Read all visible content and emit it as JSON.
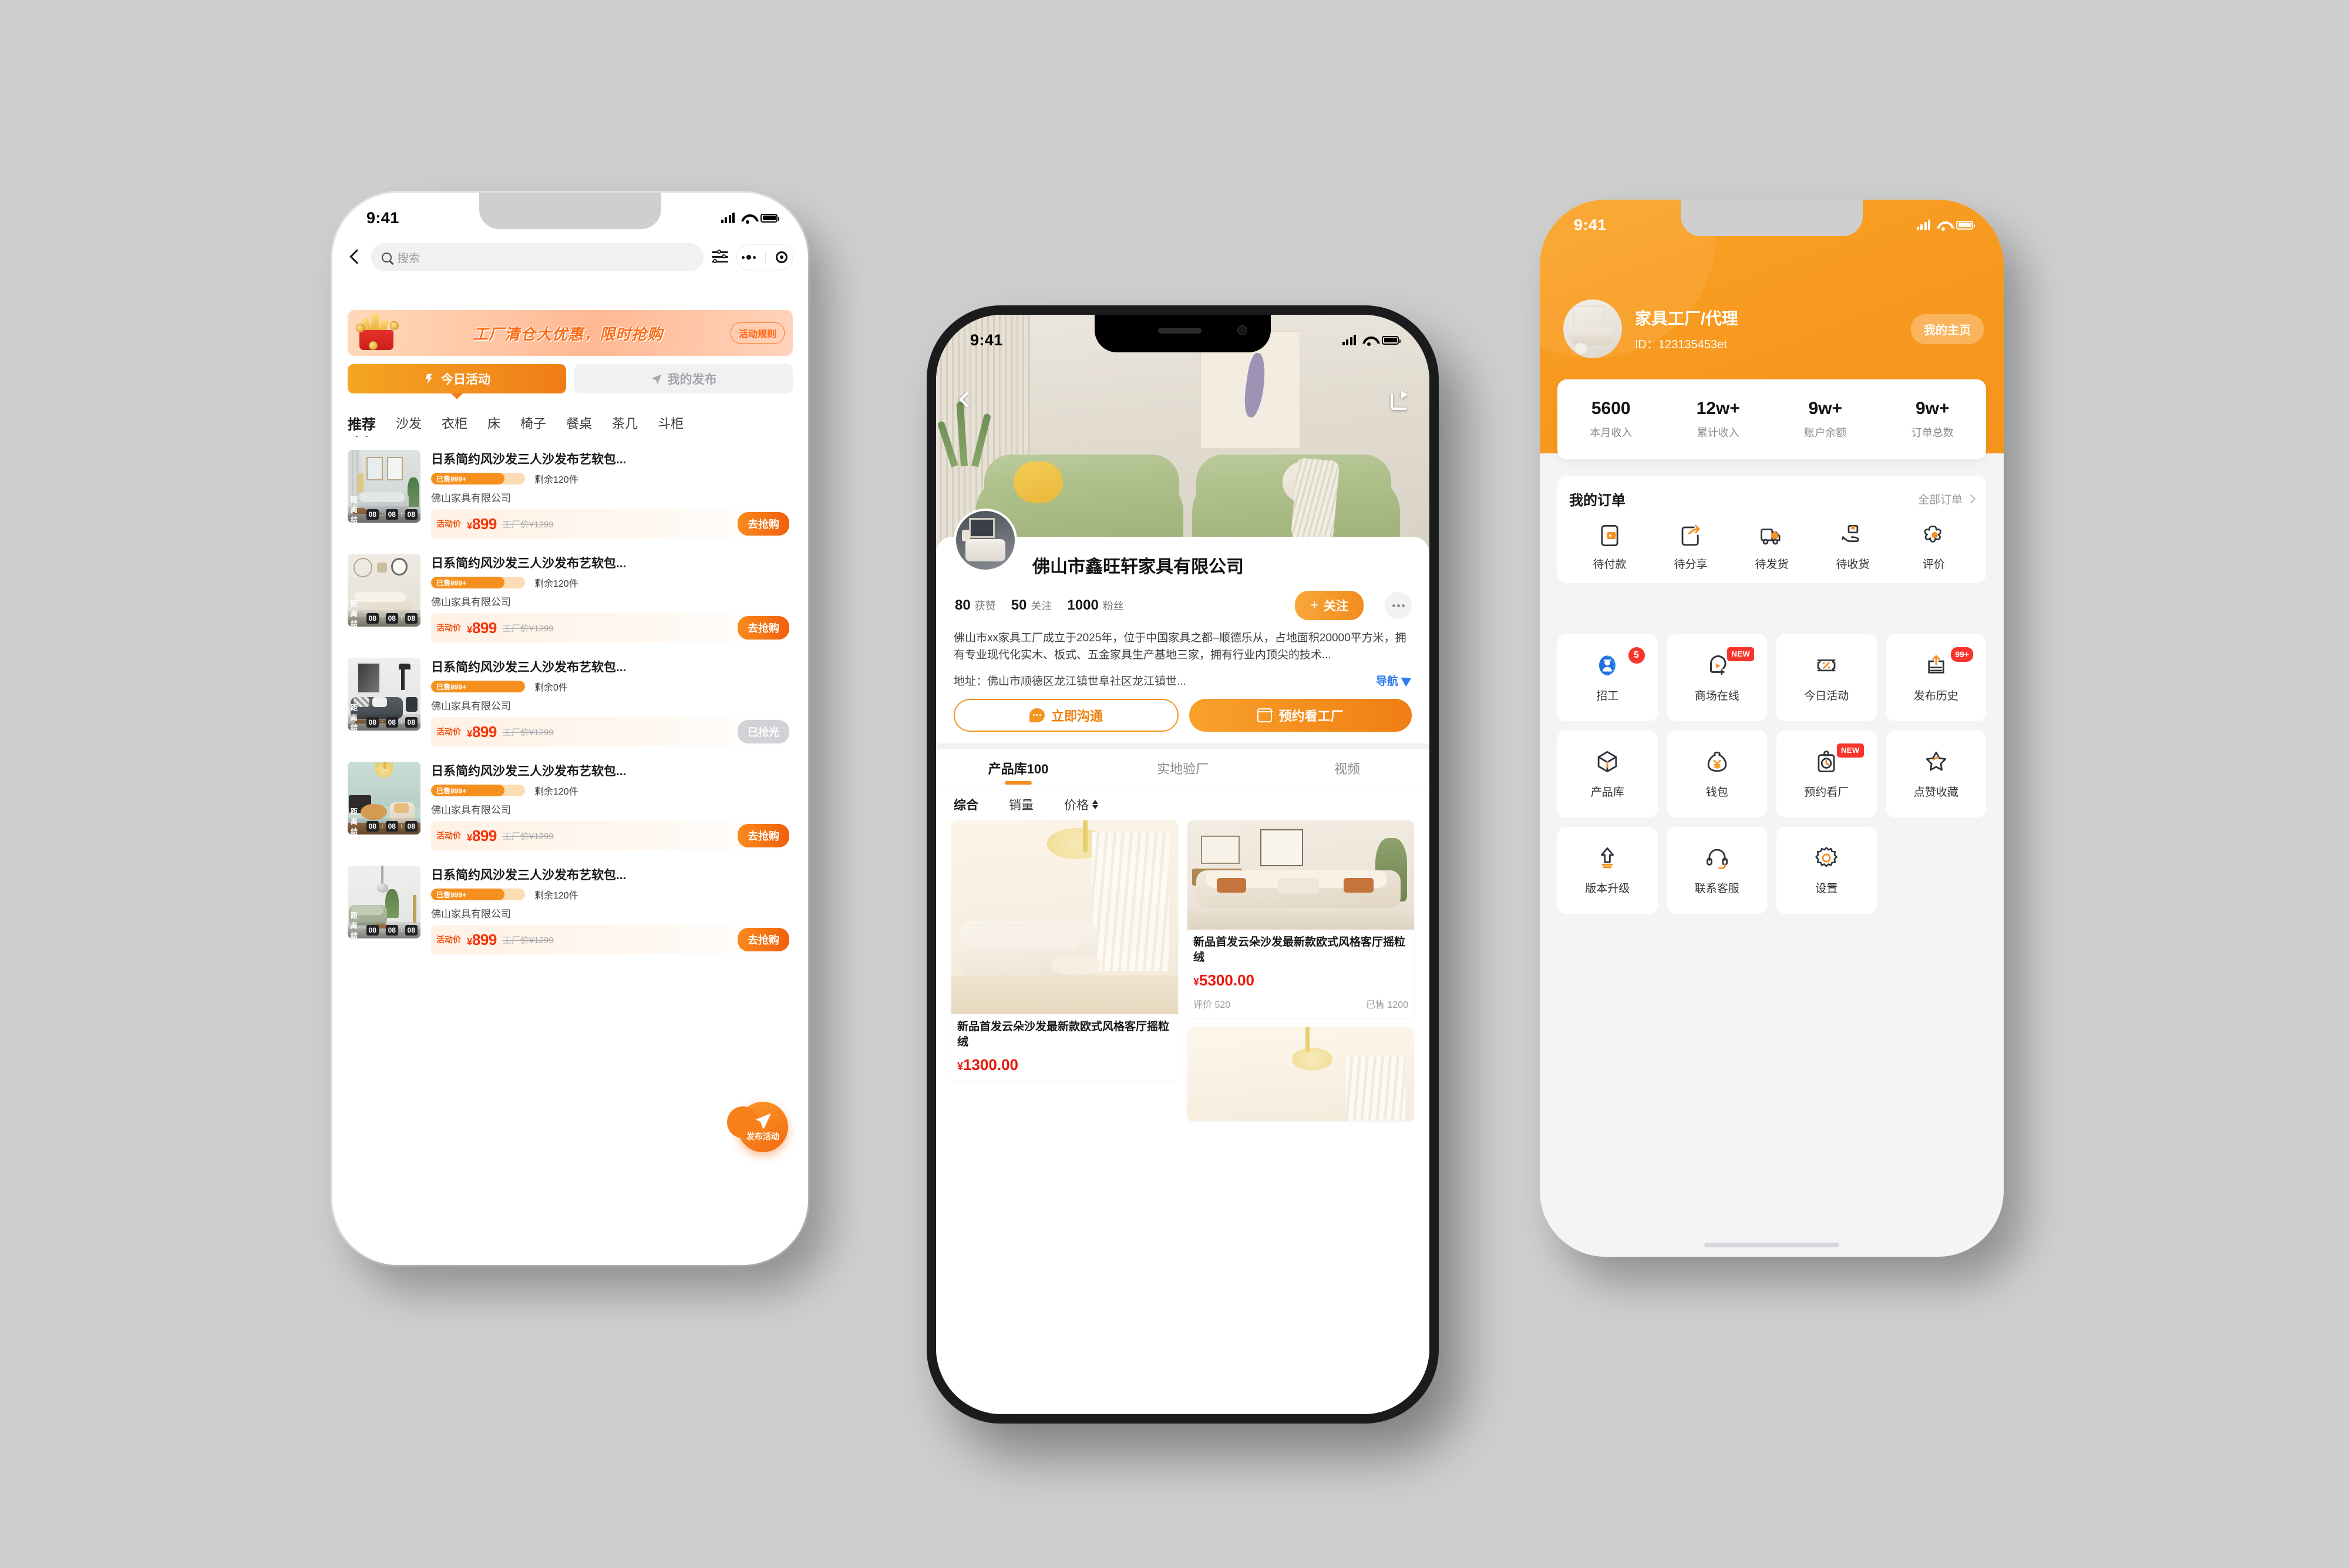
{
  "phone1": {
    "status": {
      "time": "9:41"
    },
    "search": {
      "placeholder": "搜索"
    },
    "icons": {
      "back": "back-chevron-icon",
      "filter": "filter-sliders-icon",
      "more": "more-dots-icon",
      "target": "target-icon"
    },
    "banner": {
      "text": "工厂清仓大优惠，限时抢购",
      "rule_label": "活动规则"
    },
    "tabs": [
      {
        "label": "今日活动",
        "active": true
      },
      {
        "label": "我的发布",
        "active": false
      }
    ],
    "categories": [
      "推荐",
      "沙发",
      "衣柜",
      "床",
      "椅子",
      "餐桌",
      "茶几",
      "斗柜"
    ],
    "active_category": "推荐",
    "fab": {
      "label": "发布活动"
    },
    "items": [
      {
        "title": "日系简约风沙发三人沙发布艺软包...",
        "sold": "已售999+",
        "remain": "剩余120件",
        "company": "佛山家具有限公司",
        "price_label": "活动价",
        "price": "899",
        "old_price": "工厂价¥1299",
        "button": "去抢购",
        "sold_out": false,
        "progress": 78,
        "countdown_label": "距离结束",
        "cd": [
          "08",
          "08",
          "08"
        ]
      },
      {
        "title": "日系简约风沙发三人沙发布艺软包...",
        "sold": "已售999+",
        "remain": "剩余120件",
        "company": "佛山家具有限公司",
        "price_label": "活动价",
        "price": "899",
        "old_price": "工厂价¥1299",
        "button": "去抢购",
        "sold_out": false,
        "progress": 78,
        "countdown_label": "距离结束",
        "cd": [
          "08",
          "08",
          "08"
        ]
      },
      {
        "title": "日系简约风沙发三人沙发布艺软包...",
        "sold": "已售999+",
        "remain": "剩余0件",
        "company": "佛山家具有限公司",
        "price_label": "活动价",
        "price": "899",
        "old_price": "工厂价¥1299",
        "button": "已抢光",
        "sold_out": true,
        "progress": 100,
        "countdown_label": "距离结束",
        "cd": [
          "08",
          "08",
          "08"
        ]
      },
      {
        "title": "日系简约风沙发三人沙发布艺软包...",
        "sold": "已售999+",
        "remain": "剩余120件",
        "company": "佛山家具有限公司",
        "price_label": "活动价",
        "price": "899",
        "old_price": "工厂价¥1299",
        "button": "去抢购",
        "sold_out": false,
        "progress": 78,
        "countdown_label": "距离结束",
        "cd": [
          "08",
          "08",
          "08"
        ]
      },
      {
        "title": "日系简约风沙发三人沙发布艺软包...",
        "sold": "已售999+",
        "remain": "剩余120件",
        "company": "佛山家具有限公司",
        "price_label": "活动价",
        "price": "899",
        "old_price": "工厂价¥1299",
        "button": "去抢购",
        "sold_out": false,
        "progress": 78,
        "countdown_label": "距离结束",
        "cd": [
          "08",
          "08",
          "08"
        ]
      }
    ]
  },
  "phone2": {
    "status": {
      "time": "9:41"
    },
    "hero": {
      "back": "back-chevron-icon",
      "share": "share-icon"
    },
    "shop": {
      "name": "佛山市鑫旺轩家具有限公司",
      "stats": [
        {
          "num": "80",
          "label": "获赞"
        },
        {
          "num": "50",
          "label": "关注"
        },
        {
          "num": "1000",
          "label": "粉丝"
        }
      ],
      "follow_label": "关注",
      "description": "佛山市xx家具工厂成立于2025年，位于中国家具之都–顺德乐从，占地面积20000平方米，拥有专业现代化实木、板式、五金家具生产基地三家，拥有行业内顶尖的技术...",
      "address": "地址：佛山市顺德区龙江镇世阜社区龙江镇世...",
      "nav_label": "导航"
    },
    "actions": [
      {
        "label": "立即沟通",
        "style": "ghost"
      },
      {
        "label": "预约看工厂",
        "style": "solid"
      }
    ],
    "tabs": [
      {
        "label": "产品库100",
        "active": true
      },
      {
        "label": "实地验厂",
        "active": false
      },
      {
        "label": "视频",
        "active": false
      }
    ],
    "sorts": [
      {
        "label": "综合",
        "active": true
      },
      {
        "label": "销量",
        "active": false
      },
      {
        "label": "价格",
        "active": false,
        "has_arrows": true
      }
    ],
    "products_left": [
      {
        "name": "新品首发云朵沙发最新款欧式风格客厅摇粒绒",
        "price": "1300.00",
        "img": "living-room-cream-sofa-smiley"
      }
    ],
    "products_right": [
      {
        "name": "新品首发云朵沙发最新款欧式风格客厅摇粒绒",
        "price": "5300.00",
        "reviews": "评价 520",
        "sold": "已售 1200",
        "img": "beige-sofa-art-frames"
      },
      {
        "name": "",
        "price": "",
        "img": "cream-ceiling-lamp"
      }
    ]
  },
  "phone3": {
    "status": {
      "time": "9:41"
    },
    "profile": {
      "name": "家具工厂/代理",
      "id": "ID：123135453et",
      "home_button": "我的主页"
    },
    "stats": [
      {
        "value": "5600",
        "label": "本月收入"
      },
      {
        "value": "12w+",
        "label": "累计收入"
      },
      {
        "value": "9w+",
        "label": "账户余额"
      },
      {
        "value": "9w+",
        "label": "订单总数"
      }
    ],
    "orders": {
      "title": "我的订单",
      "all_label": "全部订单",
      "items": [
        {
          "label": "待付款",
          "icon": "wallet-pay-icon"
        },
        {
          "label": "待分享",
          "icon": "share-arrow-icon"
        },
        {
          "label": "待发货",
          "icon": "truck-icon"
        },
        {
          "label": "待收货",
          "icon": "hand-package-icon"
        },
        {
          "label": "评价",
          "icon": "flower-review-icon"
        }
      ]
    },
    "grid": [
      {
        "label": "招工",
        "icon": "worker-icon",
        "badge": "5",
        "badge_type": "circle"
      },
      {
        "label": "商场在线",
        "icon": "mall-online-icon",
        "badge": "NEW",
        "badge_type": "new"
      },
      {
        "label": "今日活动",
        "icon": "coupon-percent-icon",
        "badge": "",
        "badge_type": ""
      },
      {
        "label": "发布历史",
        "icon": "publish-history-icon",
        "badge": "99+",
        "badge_type": "count"
      },
      {
        "label": "产品库",
        "icon": "cube-box-icon",
        "badge": "",
        "badge_type": ""
      },
      {
        "label": "钱包",
        "icon": "money-bag-icon",
        "badge": "",
        "badge_type": ""
      },
      {
        "label": "预约看厂",
        "icon": "appointment-clock-icon",
        "badge": "NEW",
        "badge_type": "new"
      },
      {
        "label": "点赞收藏",
        "icon": "star-icon",
        "badge": "",
        "badge_type": ""
      },
      {
        "label": "版本升级",
        "icon": "upgrade-arrow-icon",
        "badge": "",
        "badge_type": ""
      },
      {
        "label": "联系客服",
        "icon": "headset-icon",
        "badge": "",
        "badge_type": ""
      },
      {
        "label": "设置",
        "icon": "gear-icon",
        "badge": "",
        "badge_type": ""
      }
    ]
  },
  "colors": {
    "brand_orange": "#F89A20",
    "accent_orange": "#F5901F",
    "price_red": "#F5340A",
    "nav_blue": "#2B7CF2",
    "badge_red": "#F8352C",
    "page_bg": "#CFCFCF"
  }
}
